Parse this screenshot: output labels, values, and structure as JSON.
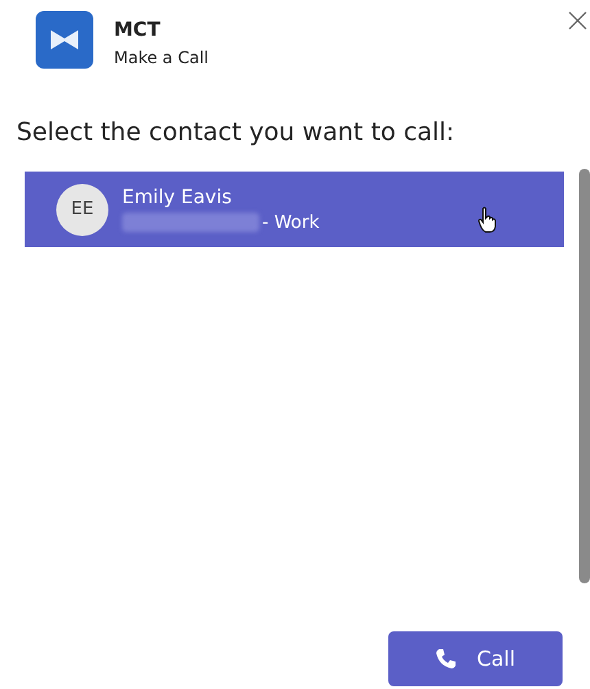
{
  "app": {
    "name": "MCT",
    "subtitle": "Make a Call"
  },
  "prompt": "Select the contact you want to call:",
  "contacts": [
    {
      "initials": "EE",
      "name": "Emily Eavis",
      "number_type": "- Work",
      "selected": true
    }
  ],
  "buttons": [
    {
      "label": "Call"
    }
  ]
}
